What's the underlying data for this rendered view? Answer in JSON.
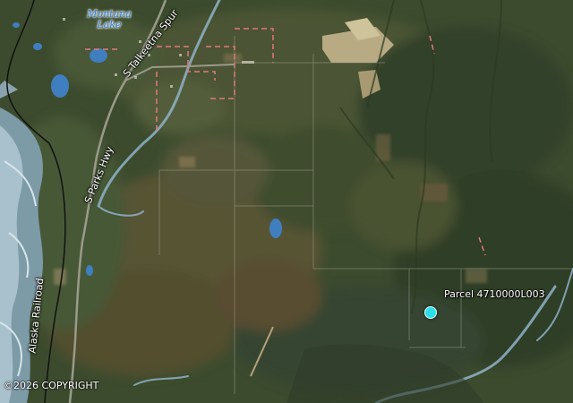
{
  "map": {
    "lake_label_line1": "Montana",
    "lake_label_line2": "Lake",
    "road_talkeetna_spur": "S Talkeetna Spur",
    "road_parks_hwy": "S Parks Hwy",
    "railroad": "Alaska Railroad",
    "parcel_label": "Parcel 4710000L003",
    "copyright": "©2026 COPYRIGHT"
  },
  "colors": {
    "marker": "#29e0ea",
    "parcel_boundary": "#e07a7a",
    "river": "#8fb3c8",
    "lake": "#3f7fc0",
    "lake_label": "#2f7fd6"
  }
}
